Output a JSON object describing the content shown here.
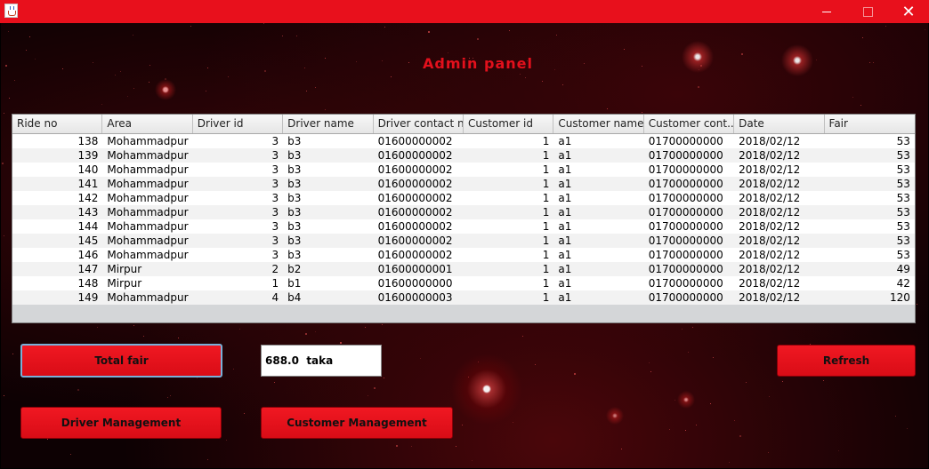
{
  "window": {
    "title": "",
    "icon": "java-cup-icon"
  },
  "panel": {
    "title": "Admin panel"
  },
  "table": {
    "columns": [
      "Ride no",
      "Area",
      "Driver id",
      "Driver name",
      "Driver contact no",
      "Customer id",
      "Customer name",
      "Customer cont...",
      "Date",
      "Fair"
    ],
    "rows": [
      [
        "138",
        "Mohammadpur",
        "3",
        "b3",
        "01600000002",
        "1",
        "a1",
        "01700000000",
        "2018/02/12",
        "53"
      ],
      [
        "139",
        "Mohammadpur",
        "3",
        "b3",
        "01600000002",
        "1",
        "a1",
        "01700000000",
        "2018/02/12",
        "53"
      ],
      [
        "140",
        "Mohammadpur",
        "3",
        "b3",
        "01600000002",
        "1",
        "a1",
        "01700000000",
        "2018/02/12",
        "53"
      ],
      [
        "141",
        "Mohammadpur",
        "3",
        "b3",
        "01600000002",
        "1",
        "a1",
        "01700000000",
        "2018/02/12",
        "53"
      ],
      [
        "142",
        "Mohammadpur",
        "3",
        "b3",
        "01600000002",
        "1",
        "a1",
        "01700000000",
        "2018/02/12",
        "53"
      ],
      [
        "143",
        "Mohammadpur",
        "3",
        "b3",
        "01600000002",
        "1",
        "a1",
        "01700000000",
        "2018/02/12",
        "53"
      ],
      [
        "144",
        "Mohammadpur",
        "3",
        "b3",
        "01600000002",
        "1",
        "a1",
        "01700000000",
        "2018/02/12",
        "53"
      ],
      [
        "145",
        "Mohammadpur",
        "3",
        "b3",
        "01600000002",
        "1",
        "a1",
        "01700000000",
        "2018/02/12",
        "53"
      ],
      [
        "146",
        "Mohammadpur",
        "3",
        "b3",
        "01600000002",
        "1",
        "a1",
        "01700000000",
        "2018/02/12",
        "53"
      ],
      [
        "147",
        "Mirpur",
        "2",
        "b2",
        "01600000001",
        "1",
        "a1",
        "01700000000",
        "2018/02/12",
        "49"
      ],
      [
        "148",
        "Mirpur",
        "1",
        "b1",
        "01600000000",
        "1",
        "a1",
        "01700000000",
        "2018/02/12",
        "42"
      ],
      [
        "149",
        "Mohammadpur",
        "4",
        "b4",
        "01600000003",
        "1",
        "a1",
        "01700000000",
        "2018/02/12",
        "120"
      ]
    ]
  },
  "buttons": {
    "total_fair": "Total fair",
    "refresh": "Refresh",
    "driver_management": "Driver Management",
    "customer_management": "Customer Management"
  },
  "total_field": {
    "value": "688.0  taka"
  },
  "colors": {
    "accent": "#e8101c",
    "title_text": "#e3101c",
    "background": "#0d0103"
  }
}
